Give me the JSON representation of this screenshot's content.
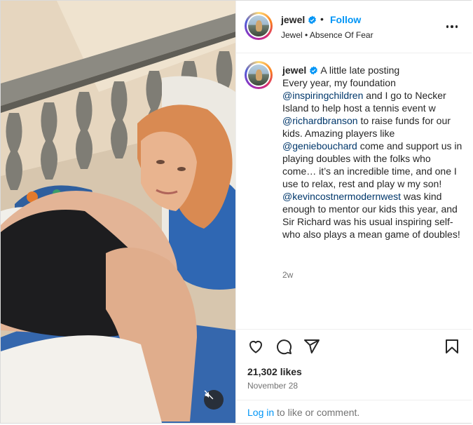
{
  "post": {
    "username": "jewel",
    "follow_label": "Follow",
    "subtitle": "Jewel • Absence Of Fear",
    "caption_parts": [
      "A little late posting\nEvery year, my foundation ",
      "@inspiringchildren",
      " and I go to Necker Island to help host a tennis event w ",
      "@richardbranson",
      " to raise funds for our kids. Amazing players like ",
      "@geniebouchard",
      " come and support us in playing doubles with the folks who come… it’s an incredible time, and one I use to relax, rest and play w my son! ",
      "@kevincostnermodernwest",
      " was kind enough to mentor our kids this year, and Sir Richard was his usual inspiring self- who also plays a mean game of doubles!"
    ],
    "time_ago": "2w",
    "likes": "21,302 likes",
    "date": "November 28",
    "login_label": "Log in",
    "login_suffix": " to like or comment."
  },
  "icons": {
    "verified": "verified-badge-icon",
    "more": "more-options-icon",
    "like": "heart-icon",
    "comment": "comment-icon",
    "share": "share-icon",
    "save": "bookmark-icon",
    "mute": "speaker-muted-icon"
  },
  "colors": {
    "link_blue": "#0095f6",
    "mention_blue": "#00376b",
    "verified_blue": "#0095f6",
    "text": "#262626",
    "muted": "#737373"
  }
}
